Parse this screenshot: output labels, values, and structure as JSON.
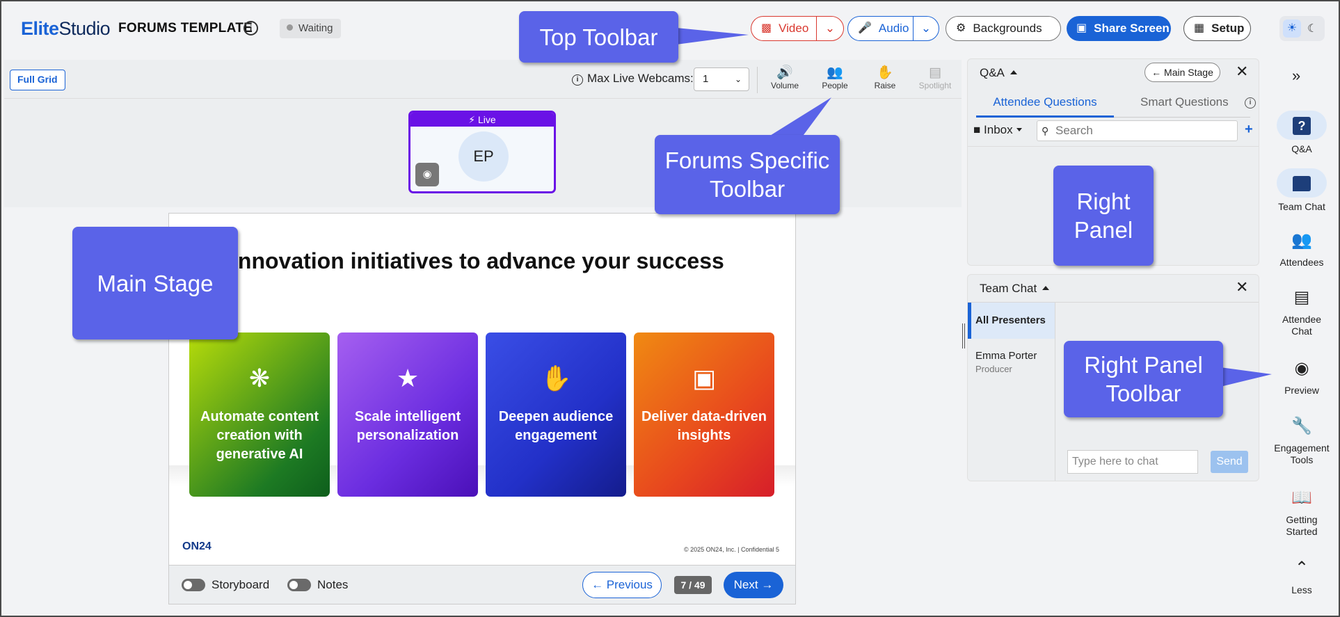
{
  "app": {
    "brand_part1": "Elite",
    "brand_part2": "Studio",
    "event_title": "FORUMS TEMPLATE",
    "status": "Waiting"
  },
  "top_toolbar": {
    "video_label": "Video",
    "audio_label": "Audio",
    "backgrounds_label": "Backgrounds",
    "share_screen_label": "Share Screen",
    "setup_label": "Setup"
  },
  "forums_toolbar": {
    "full_grid_label": "Full Grid",
    "max_webcams_label": "Max Live Webcams:",
    "max_webcams_value": "1",
    "items": [
      {
        "label": "Volume",
        "icon": "speaker-icon"
      },
      {
        "label": "People",
        "icon": "people-icon"
      },
      {
        "label": "Raise",
        "icon": "hand-icon"
      },
      {
        "label": "Spotlight",
        "icon": "spotlight-icon"
      }
    ]
  },
  "webcam": {
    "live_label": "Live",
    "initials": "EP"
  },
  "slide": {
    "title": "Innovation initiatives to advance your success",
    "cards": [
      {
        "text": "Automate content creation with generative AI",
        "icon": "brain-icon"
      },
      {
        "text": "Scale intelligent personalization",
        "icon": "id-card-star-icon"
      },
      {
        "text": "Deepen audience engagement",
        "icon": "raised-hands-icon"
      },
      {
        "text": "Deliver data-driven insights",
        "icon": "dashboard-icon"
      }
    ],
    "logo": "ON24",
    "copyright": "© 2025 ON24, Inc.  |  Confidential   5"
  },
  "stage_footer": {
    "storyboard_label": "Storyboard",
    "notes_label": "Notes",
    "previous_label": "← Previous",
    "page": "7 / 49",
    "next_label": "Next →"
  },
  "qa_panel": {
    "title": "Q&A",
    "main_stage_label": "← Main Stage",
    "tabs": [
      "Attendee Questions",
      "Smart Questions"
    ],
    "inbox_label": "Inbox",
    "search_placeholder": "Search"
  },
  "team_chat": {
    "title": "Team Chat",
    "channel": "All Presenters",
    "user_name": "Emma Porter",
    "user_role": "Producer",
    "input_placeholder": "Type here to chat",
    "send_label": "Send"
  },
  "right_toolbar": {
    "items": [
      {
        "label": "Q&A",
        "icon": "qa-icon"
      },
      {
        "label": "Team Chat",
        "icon": "team-chat-icon"
      },
      {
        "label": "Attendees",
        "icon": "attendees-icon"
      },
      {
        "label": "Attendee Chat",
        "icon": "chat-icon"
      },
      {
        "label": "Preview",
        "icon": "eye-icon"
      },
      {
        "label": "Engagement Tools",
        "icon": "wrench-icon"
      },
      {
        "label": "Getting Started",
        "icon": "book-icon"
      },
      {
        "label": "Less",
        "icon": "chevron-up-icon"
      }
    ]
  },
  "annotations": {
    "top_toolbar": "Top Toolbar",
    "forums_toolbar_1": "Forums Specific",
    "forums_toolbar_2": "Toolbar",
    "main_stage": "Main Stage",
    "right_panel_1": "Right",
    "right_panel_2": "Panel",
    "right_panel_toolbar_1": "Right Panel",
    "right_panel_toolbar_2": "Toolbar"
  },
  "colors": {
    "accent": "#1a63d6",
    "video_red": "#d9382f",
    "live_purple": "#6a12e6",
    "callout": "#5a63e8"
  }
}
